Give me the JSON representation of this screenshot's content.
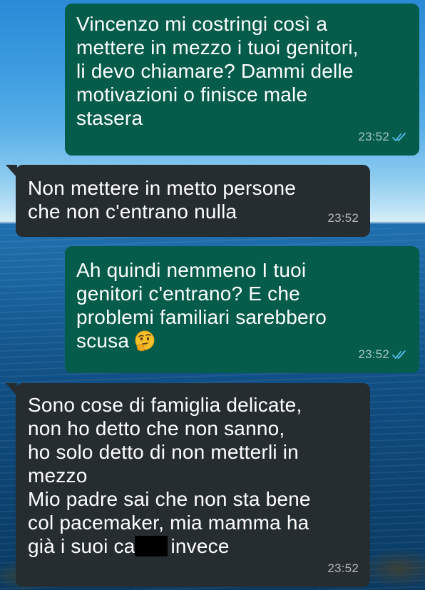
{
  "chat": {
    "messages": [
      {
        "direction": "outgoing",
        "lines": [
          "Vincenzo mi costringi così a",
          "mettere in mezzo i tuoi genitori,",
          "li devo chiamare? Dammi delle",
          "motivazioni o finisce male",
          "stasera"
        ],
        "time": "23:52",
        "status_icon": "double-check-read-icon"
      },
      {
        "direction": "incoming",
        "lines": [
          "Non mettere in metto persone",
          "che non c'entrano nulla"
        ],
        "time": "23:52"
      },
      {
        "direction": "outgoing",
        "lines": [
          "Ah quindi nemmeno I tuoi",
          "genitori c'entrano? E che",
          "problemi familiari sarebbero",
          "scusa"
        ],
        "emoji": "thinking-face-emoji",
        "time": "23:52",
        "status_icon": "double-check-read-icon"
      },
      {
        "direction": "incoming",
        "lines": [
          "Sono cose di famiglia delicate,",
          "non ho detto che non sanno,",
          "ho solo detto di non metterli in",
          "mezzo",
          "Mio padre sai che non sta bene",
          "col pacemaker, mia mamma ha",
          "già i suoi ca"
        ],
        "redacted_after": "ca",
        "last_line_suffix": "invece",
        "time": "23:52"
      }
    ]
  },
  "colors": {
    "outgoing_bubble": "#055c4b",
    "incoming_bubble": "#262d31",
    "read_ticks": "#53bdeb",
    "text": "#ffffff"
  },
  "background": {
    "description_icon": "sea-horizon-wallpaper"
  }
}
